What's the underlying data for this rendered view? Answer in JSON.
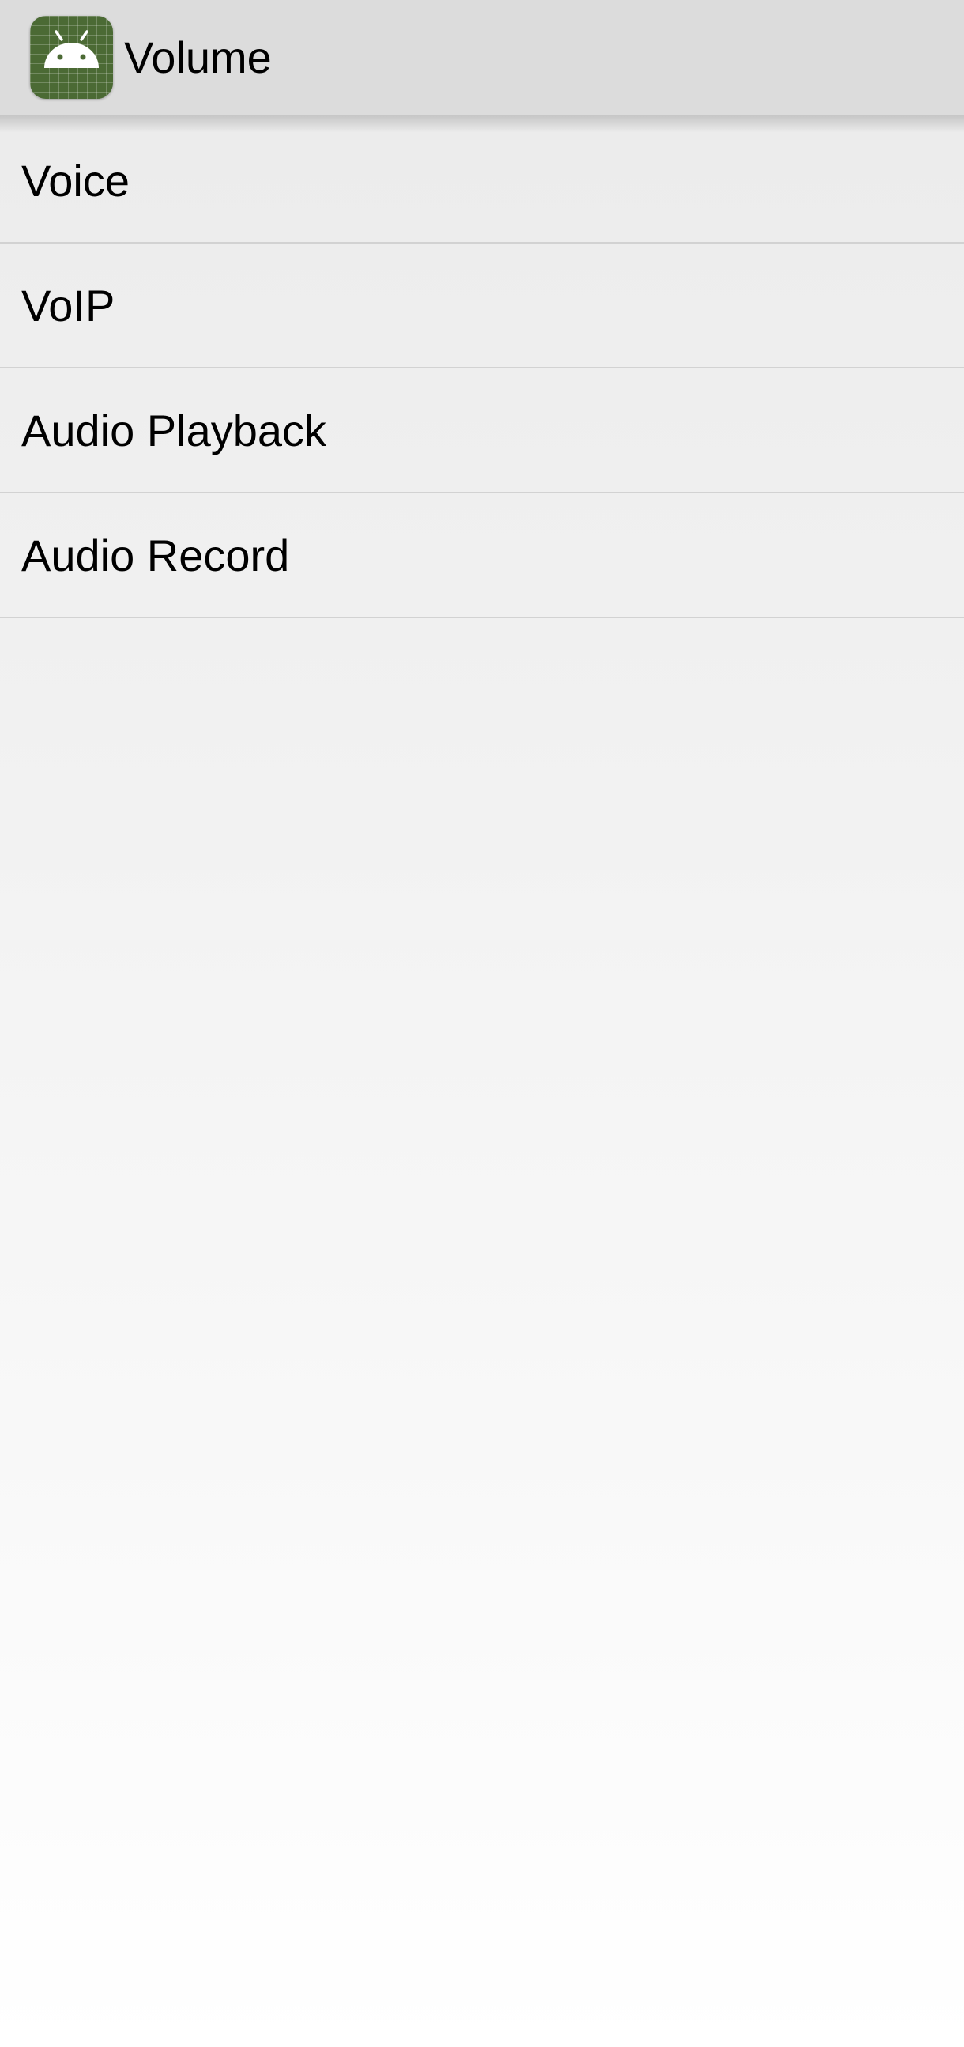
{
  "action_bar": {
    "title": "Volume",
    "icon": "android-app-icon"
  },
  "list": {
    "items": [
      {
        "label": "Voice"
      },
      {
        "label": "VoIP"
      },
      {
        "label": "Audio Playback"
      },
      {
        "label": "Audio Record"
      }
    ]
  },
  "colors": {
    "action_bar_bg": "#dcdcdc",
    "icon_bg": "#4b6a34",
    "divider": "#d2d2d2",
    "text": "#000000"
  }
}
